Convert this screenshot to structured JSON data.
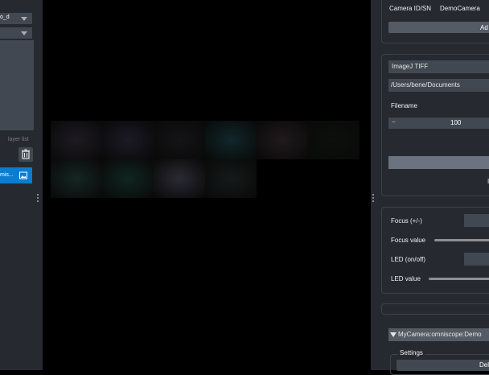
{
  "left_panel": {
    "dropdown1_value": "o_d",
    "dropdown2_value": "",
    "layer_list_label": "layer list",
    "layer_item_label": "mis..."
  },
  "viewer": {
    "tiles": [
      {
        "color": "#1e1b22"
      },
      {
        "color": "#1b1a25"
      },
      {
        "color": "#141316"
      },
      {
        "color": "#10272a"
      },
      {
        "color": "#201a1d"
      },
      {
        "color": "#0b100b"
      },
      {
        "color": "#142623"
      },
      {
        "color": "#102620"
      },
      {
        "color": "#2a2a33"
      },
      {
        "color": "#141a19"
      }
    ]
  },
  "right_panel": {
    "camera_id_label": "Camera ID/SN",
    "camera_id_value": "DemoCamera",
    "add_button_label": "Ad",
    "format_value": "ImageJ TIFF",
    "path_value": "/Users/bene/Documents",
    "filename_label": "Filename",
    "stepper_minus": "−",
    "stepper_value": "100",
    "small_text": "I",
    "focus_label": "Focus (+/-)",
    "focus_value_label": "Focus value",
    "led_label": "LED (on/off)",
    "led_value_label": "LED value",
    "camera_tree_label": "MyCamera:omniscope:Demo",
    "settings_label": "Settings",
    "delete_button_label": "Dele"
  },
  "colors": {
    "panel_bg": "#262930",
    "field_bg": "#414851",
    "selected_layer": "#0a7dd1"
  }
}
